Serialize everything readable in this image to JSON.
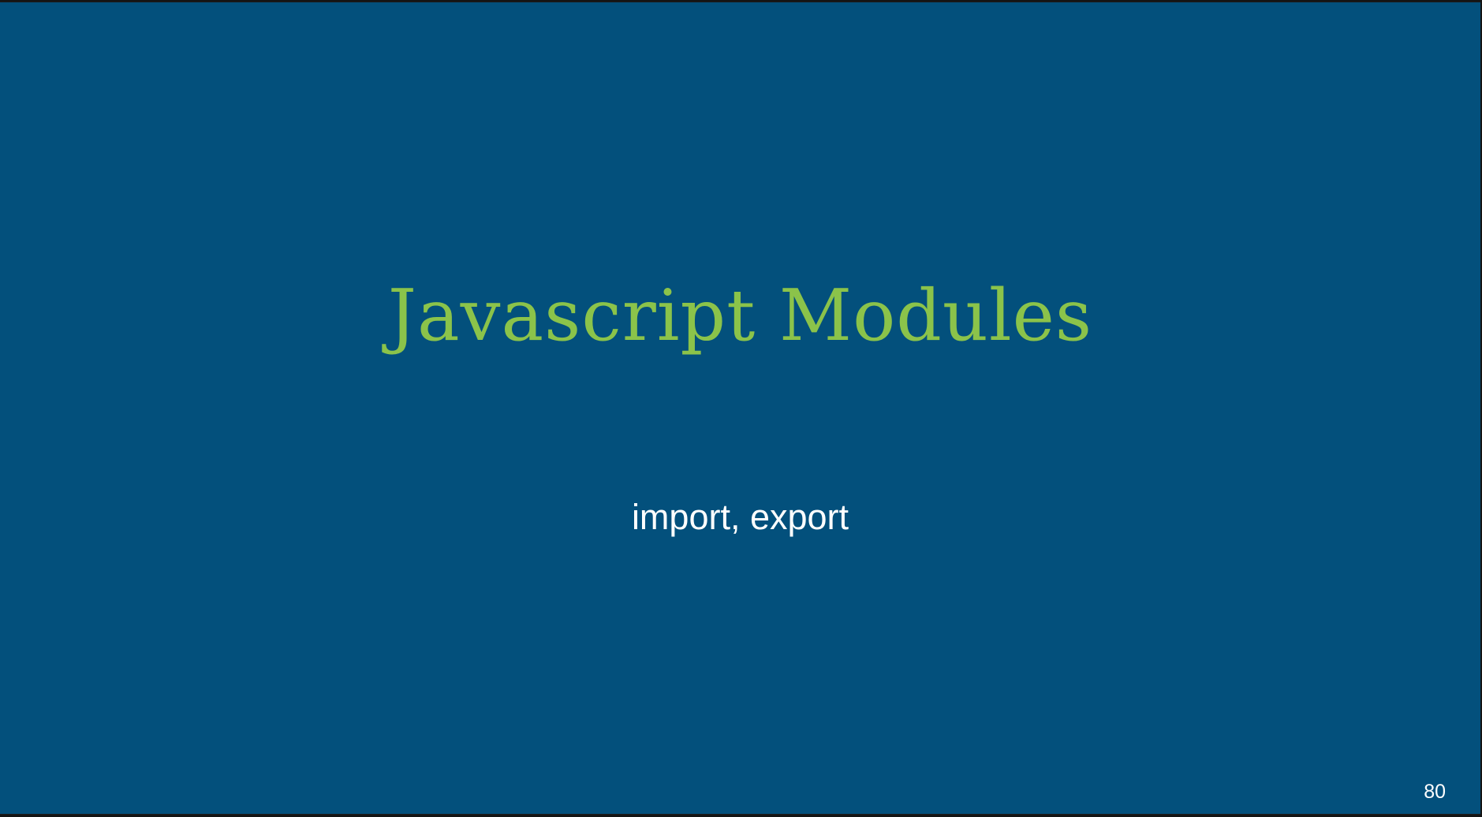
{
  "slide": {
    "title": "Javascript Modules",
    "subtitle": "import, export",
    "page_number": "80"
  },
  "colors": {
    "background": "#03507c",
    "title": "#8bc34a",
    "text": "#ffffff"
  }
}
